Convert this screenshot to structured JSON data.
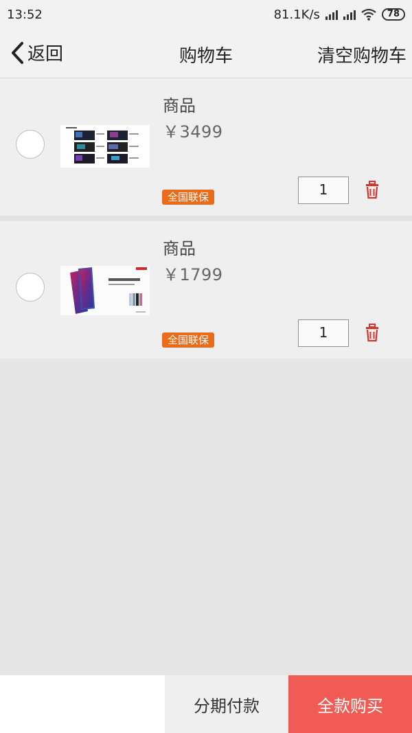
{
  "status_bar": {
    "time": "13:52",
    "network_speed": "81.1K/s",
    "battery": "78"
  },
  "header": {
    "back_label": "返回",
    "title": "购物车",
    "clear_label": "清空购物车"
  },
  "cart": {
    "items": [
      {
        "name": "商品",
        "price": "￥3499",
        "badge": "全国联保",
        "quantity": "1"
      },
      {
        "name": "商品",
        "price": "￥1799",
        "badge": "全国联保",
        "quantity": "1"
      }
    ]
  },
  "bottom_bar": {
    "installment_label": "分期付款",
    "full_pay_label": "全款购买"
  },
  "colors": {
    "accent_red": "#f05b55",
    "badge_orange": "#ea6c1a",
    "trash_red": "#d9342b"
  }
}
